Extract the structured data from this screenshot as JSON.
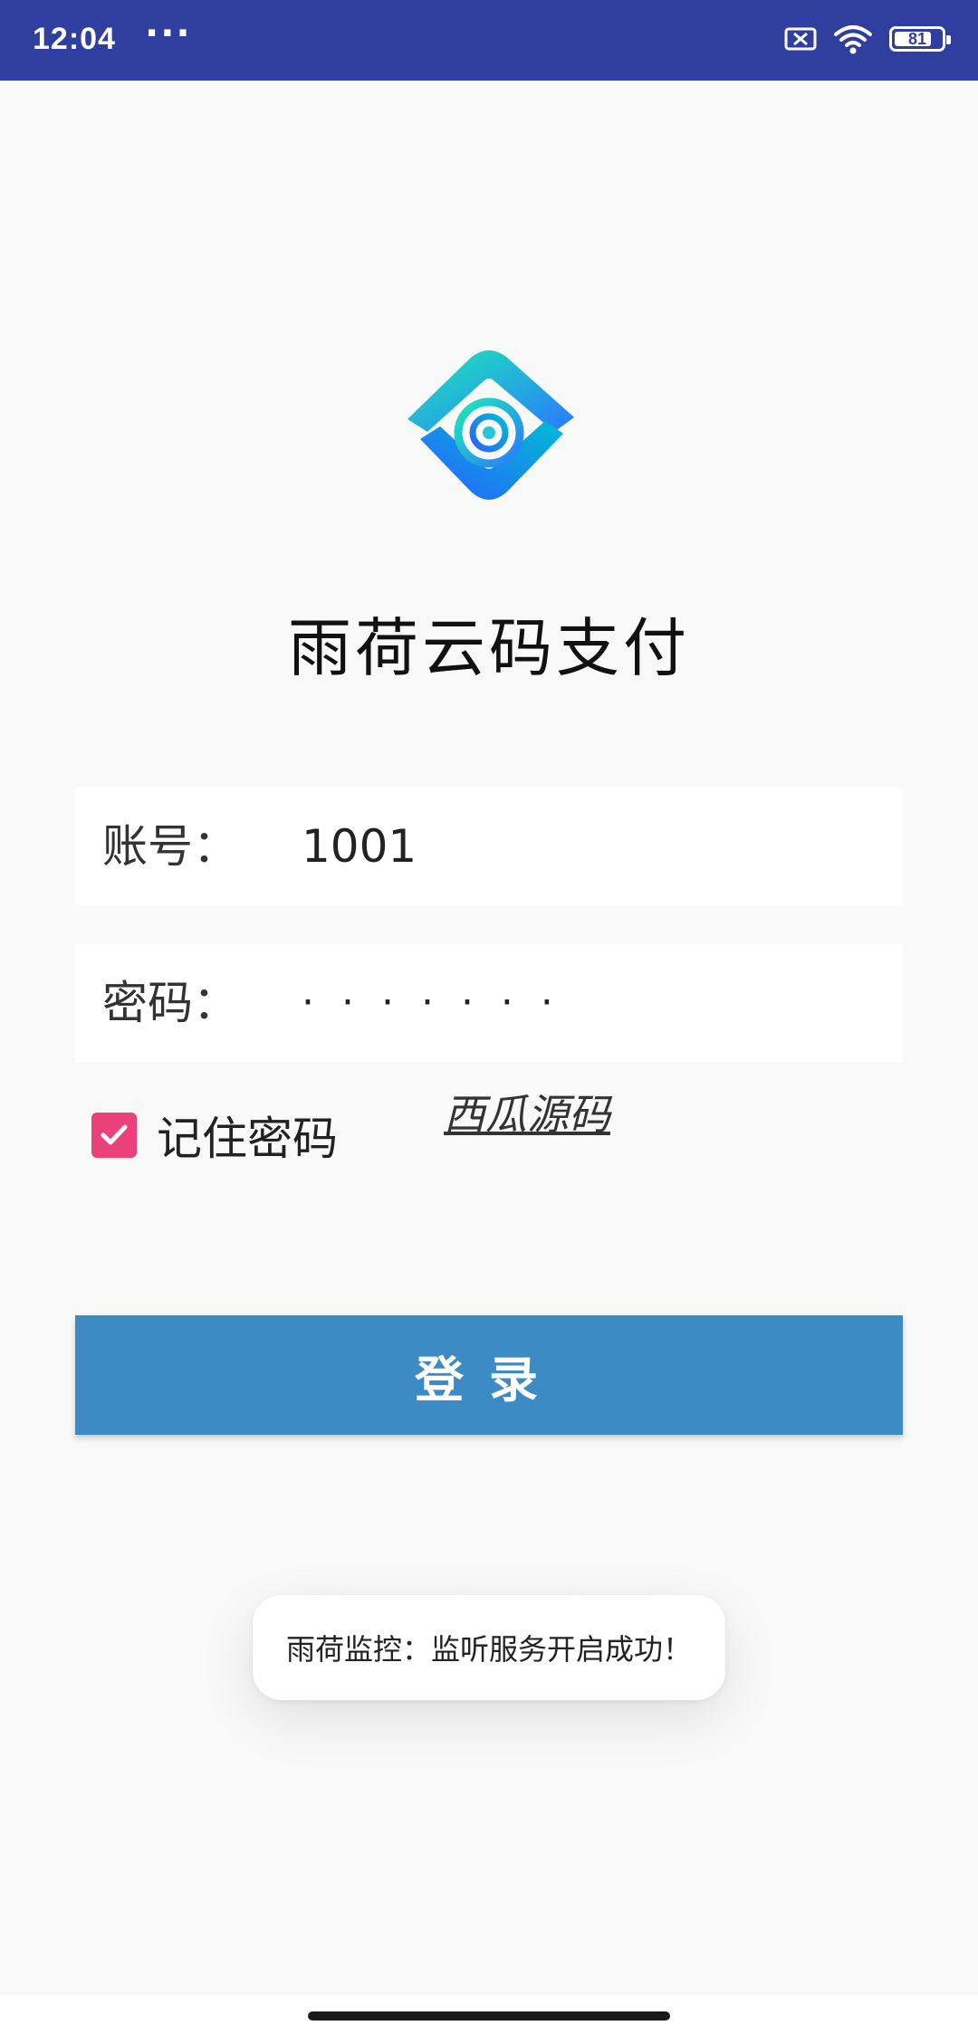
{
  "status_bar": {
    "time": "12:04",
    "notification_dots": "···",
    "battery_level": "81",
    "icons": [
      "sim-off-icon",
      "wifi-icon",
      "battery-icon"
    ],
    "background_color": "#303f9f"
  },
  "app": {
    "logo": "eye-logo-icon",
    "title": "雨荷云码支付"
  },
  "form": {
    "account_label": "账号：",
    "account_value": "1001",
    "password_label": "密码：",
    "password_value": "·······",
    "remember_label": "记住密码",
    "remember_checked": true,
    "promo_link": "西瓜源码",
    "login_button": "登录",
    "accent_color": "#ec407a",
    "button_color": "#3d8bc4"
  },
  "toast": {
    "message": "雨荷监控：监听服务开启成功！"
  }
}
